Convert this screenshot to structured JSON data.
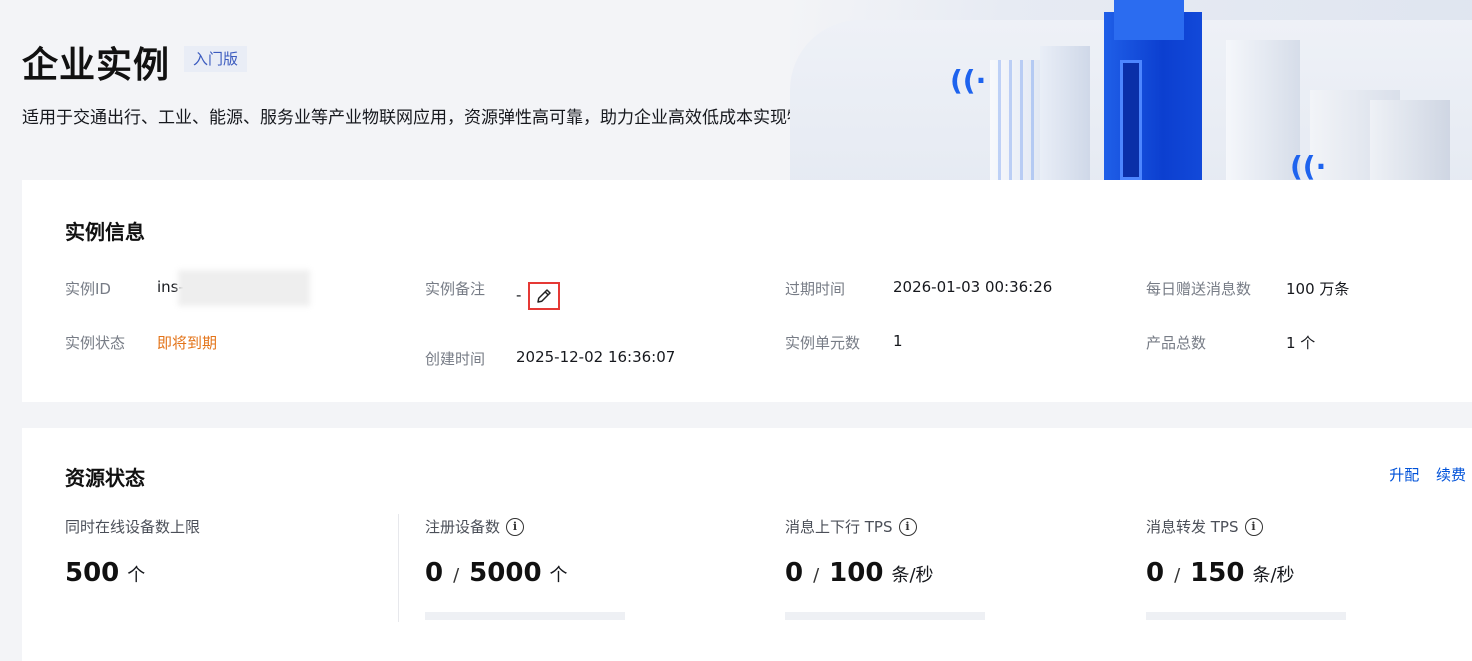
{
  "header": {
    "title": "企业实例",
    "edition_tag": "入门版",
    "description": "适用于交通出行、工业、能源、服务业等产业物联网应用，资源弹性高可靠，助力企业高效低成本实现物联应用方案。"
  },
  "instance_info": {
    "title": "实例信息",
    "id_label": "实例ID",
    "id_value": "ins-",
    "status_label": "实例状态",
    "status_value": "即将到期",
    "remark_label": "实例备注",
    "remark_value": "-",
    "created_label": "创建时间",
    "created_value": "2025-12-02 16:36:07",
    "expire_label": "过期时间",
    "expire_value": "2026-01-03 00:36:26",
    "units_label": "实例单元数",
    "units_value": "1",
    "daily_msgs_label": "每日赠送消息数",
    "daily_msgs_value": "100 万条",
    "products_label": "产品总数",
    "products_value": "1 个"
  },
  "resource_status": {
    "title": "资源状态",
    "upgrade_link": "升配",
    "renew_link": "续费",
    "stats": [
      {
        "label": "同时在线设备数上限",
        "value": "500",
        "unit": "个"
      },
      {
        "label": "注册设备数",
        "used": "0",
        "slash": "/",
        "total": "5000",
        "unit": "个",
        "usage_fraction": 0
      },
      {
        "label": "消息上下行 TPS",
        "used": "0",
        "slash": "/",
        "total": "100",
        "unit": "条/秒",
        "usage_fraction": 0
      },
      {
        "label": "消息转发 TPS",
        "used": "0",
        "slash": "/",
        "total": "150",
        "unit": "条/秒",
        "usage_fraction": 0
      }
    ]
  },
  "colors": {
    "accent": "#0052d9",
    "warning": "#e37318",
    "background": "#f3f4f7"
  }
}
